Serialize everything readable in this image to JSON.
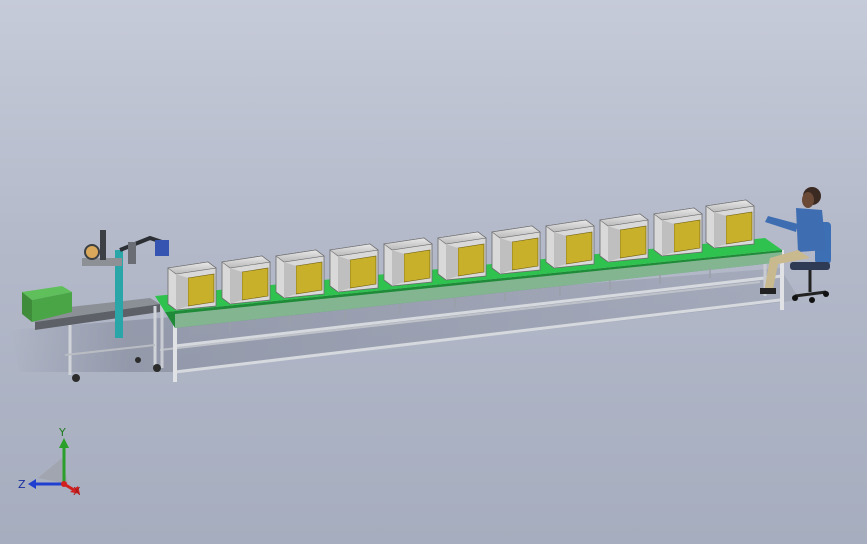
{
  "axis_triad": {
    "y_label": "Y",
    "z_label": "Z",
    "x_label": "X",
    "y_color": "#2aa02a",
    "z_color": "#1f3fd0",
    "x_color": "#d02020"
  },
  "scene": {
    "background_top": "#c6cbd9",
    "background_bottom": "#a6adbe",
    "conveyor_belt_color": "#2fc24f",
    "frame_color": "#c8ccd2",
    "bin_count": 11,
    "bin_face_color": "#c9b02a",
    "operator_shirt_color": "#3e6db2"
  }
}
